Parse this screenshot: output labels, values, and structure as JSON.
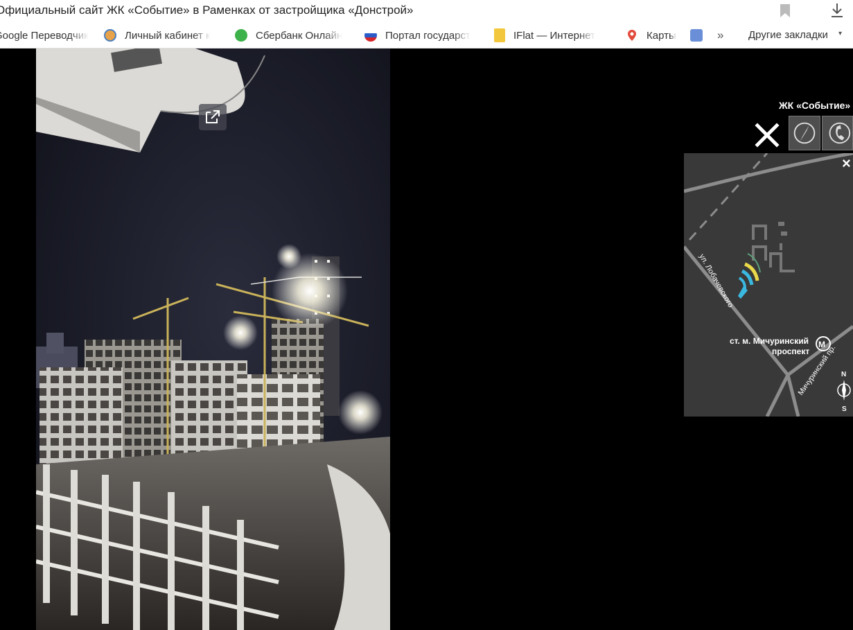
{
  "browser": {
    "page_title": "Официальный сайт ЖК «Событие» в Раменках от застройщика «Донстрой»",
    "bookmarks": [
      {
        "label": "Google Переводчик",
        "icon": "google-translate-icon"
      },
      {
        "label": "Личный кабинет к",
        "icon": "rbc-icon"
      },
      {
        "label": "Сбербанк Онлайн",
        "icon": "sberbank-icon"
      },
      {
        "label": "Портал государст",
        "icon": "russia-flag-icon"
      },
      {
        "label": "IFlat — Интернет",
        "icon": "info-icon"
      },
      {
        "label": "Карты",
        "icon": "map-pin-icon"
      },
      {
        "label": "",
        "icon": "mail-icon"
      }
    ],
    "more_glyph": "»",
    "other_bookmarks": "Другие закладки",
    "other_caret": "▾"
  },
  "viewer": {
    "project_label": "ЖК «Событие»",
    "map": {
      "street_1": "ул. Лобачевского",
      "metro_line_1": "ст. м. Мичуринский",
      "metro_line_2": "проспект",
      "metro_symbol": "М",
      "street_2": "Мичуринский пр.",
      "compass_n": "N",
      "compass_s": "S",
      "close_glyph": "×"
    }
  }
}
